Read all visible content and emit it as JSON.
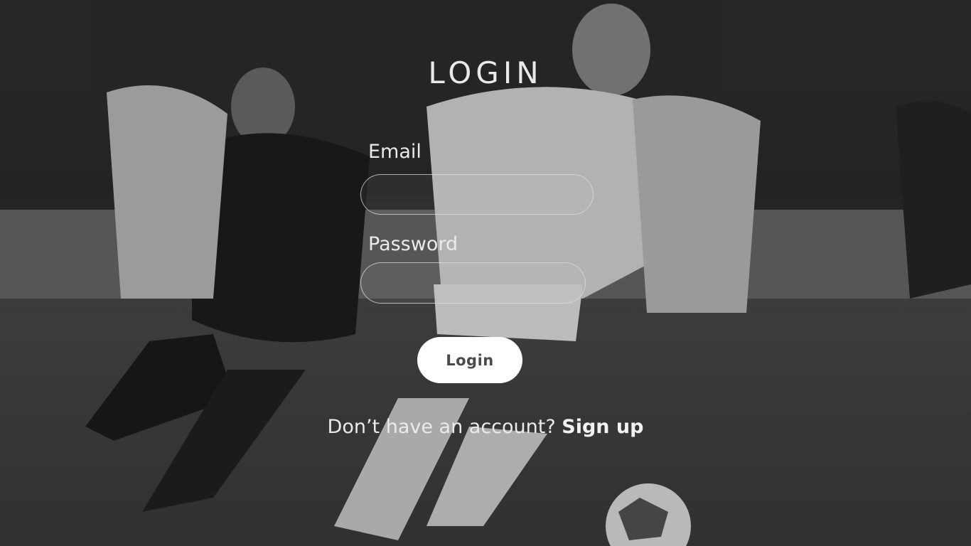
{
  "page": {
    "title": "LOGIN"
  },
  "form": {
    "email_label": "Email",
    "email_value": "",
    "password_label": "Password",
    "password_value": "",
    "login_button_label": "Login"
  },
  "footer": {
    "prompt_text": "Don’t have an account?",
    "signup_link_label": "Sign up"
  },
  "colors": {
    "button_background": "#ffffff",
    "button_text": "#4a4a4a",
    "text": "#eaeaea"
  }
}
